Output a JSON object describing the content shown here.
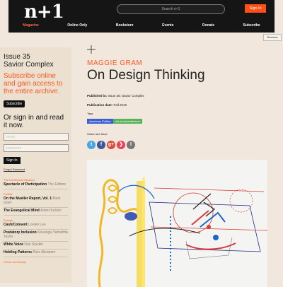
{
  "header": {
    "logo": "n+1",
    "search_placeholder": "Search n+1",
    "signin_label": "Sign In"
  },
  "nav": {
    "items": [
      "Magazine",
      "Online Only",
      "Bookstore",
      "Events",
      "Donate",
      "Subscribe"
    ],
    "active_index": 0
  },
  "reviews_tab": "Reviews",
  "sidebar": {
    "issue_number": "Issue 35",
    "issue_title": "Savior Complex",
    "subscribe_prompt": "Subscribe online and gain access to the entire archive.",
    "subscribe_button": "Subscribe",
    "signin_prompt": "Or sign in and read it now.",
    "email_placeholder": "email",
    "password_placeholder": "password",
    "signin_button": "Sign In",
    "forgot_password": "Forgot Password",
    "toc": [
      {
        "section": "The Intellectual Situation",
        "title": "Spectacle of Participation",
        "author": "The Editors"
      },
      {
        "section": "Politics",
        "title": "On the Mueller Report, Vol. 1",
        "author": "Mark Greif"
      },
      {
        "section": "",
        "title": "The Evangelical Mind",
        "author": "Adam Kotsko"
      },
      {
        "section": "Essays",
        "title": "Cash/Consent",
        "author": "Lorelei Lee"
      },
      {
        "section": "",
        "title": "Predatory Inclusion",
        "author": "Keeanga-Yamahtta Taylor"
      },
      {
        "section": "",
        "title": "White Voice",
        "author": "Dan Sinykin"
      },
      {
        "section": "",
        "title": "Holding Patterns",
        "author": "Alice Abraham"
      },
      {
        "section": "Fiction and Essay",
        "title": "",
        "author": ""
      }
    ]
  },
  "article": {
    "author": "MAGGIE GRAM",
    "title": "On Design Thinking",
    "published_in_label": "Published in:",
    "published_in_value": "Issue 35: Savior Complex",
    "publication_date_label": "Publication date:",
    "publication_date_value": "Fall 2019",
    "tags_label": "Tags",
    "tags": [
      "American Politics",
      "Art and Architecture"
    ],
    "share_label": "Share and Save",
    "share_icons": [
      {
        "name": "twitter-icon",
        "glyph": "t",
        "color": "#45a6e1"
      },
      {
        "name": "facebook-icon",
        "glyph": "f",
        "color": "#3b5998"
      },
      {
        "name": "google-plus-icon",
        "glyph": "g+",
        "color": "#dd4b39"
      },
      {
        "name": "pocket-icon",
        "glyph": "❯",
        "color": "#ee4056"
      },
      {
        "name": "instapaper-icon",
        "glyph": "I",
        "color": "#777777"
      }
    ]
  },
  "colors": {
    "accent": "#ff5a1f",
    "topbar": "#151515",
    "background": "#f1e7dc",
    "sidebar": "#ece0d1"
  }
}
